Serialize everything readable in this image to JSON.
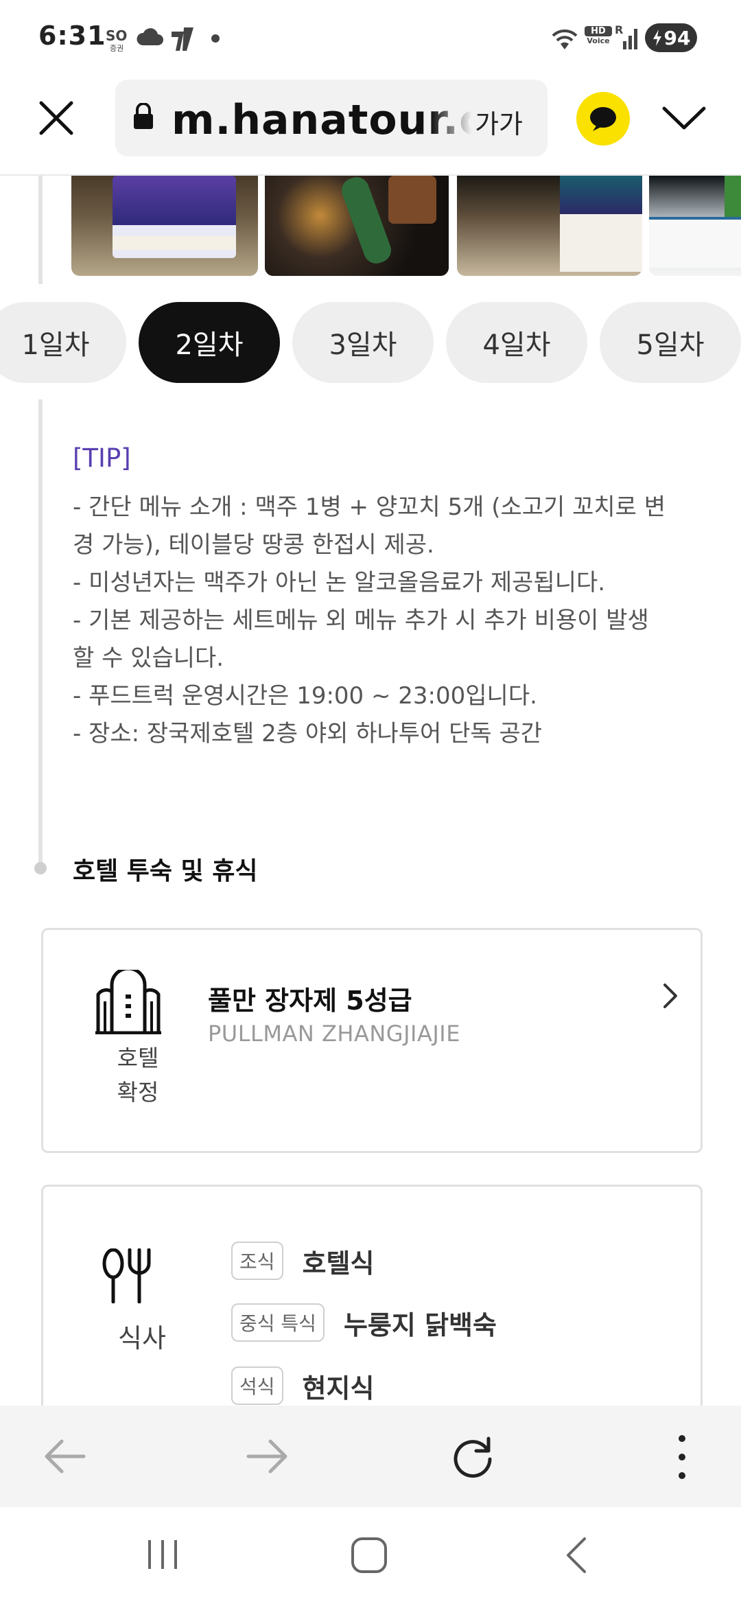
{
  "status_bar": {
    "time": "6:31",
    "carrier": "SO",
    "carrier_sub": "증권",
    "hd_voice_top": "HD",
    "hd_voice_bottom": "Voice",
    "roaming": "R",
    "battery": "94",
    "icons": [
      "cloud-icon",
      "app-notification-icon",
      "dot-icon",
      "wifi-icon",
      "signal-icon",
      "battery-charging-icon"
    ]
  },
  "browser": {
    "url": "m.hanatour.com",
    "text_size_label": "가가",
    "icons": [
      "close-icon",
      "lock-icon",
      "kakaotalk-icon",
      "chevron-down-icon"
    ]
  },
  "day_tabs": [
    {
      "label": "1일차",
      "active": false
    },
    {
      "label": "2일차",
      "active": true
    },
    {
      "label": "3일차",
      "active": false
    },
    {
      "label": "4일차",
      "active": false
    },
    {
      "label": "5일차",
      "active": false
    }
  ],
  "tip": {
    "title": "[TIP]",
    "lines": [
      "- 간단 메뉴 소개 : 맥주 1병 + 양꼬치 5개 (소고기 꼬치로 변",
      "경 가능), 테이블당 땅콩 한접시 제공.",
      "- 미성년자는 맥주가 아닌 논 알코올음료가 제공됩니다.",
      "- 기본 제공하는 세트메뉴 외 메뉴 추가 시 추가 비용이 발생",
      "할 수 있습니다.",
      "- 푸드트럭 운영시간은 19:00 ~ 23:00입니다.",
      "- 장소: 장국제호텔 2층 야외 하나투어 단독 공간"
    ]
  },
  "section_title": "호텔 투숙 및 휴식",
  "hotel": {
    "label_line1": "호텔",
    "label_line2": "확정",
    "name": "풀만 장자제 5성급",
    "name_en": "PULLMAN ZHANGJIAJIE"
  },
  "meals": {
    "label": "식사",
    "rows": [
      {
        "tag": "조식",
        "value": "호텔식"
      },
      {
        "tag": "중식 특식",
        "value": "누룽지 닭백숙"
      },
      {
        "tag": "석식",
        "value": "현지식"
      }
    ]
  },
  "bottom_toolbar": {
    "icons": [
      "back-arrow-icon",
      "forward-arrow-icon",
      "refresh-icon",
      "more-vertical-icon"
    ]
  },
  "system_nav": {
    "icons": [
      "recent-apps-icon",
      "home-icon",
      "back-icon"
    ]
  }
}
